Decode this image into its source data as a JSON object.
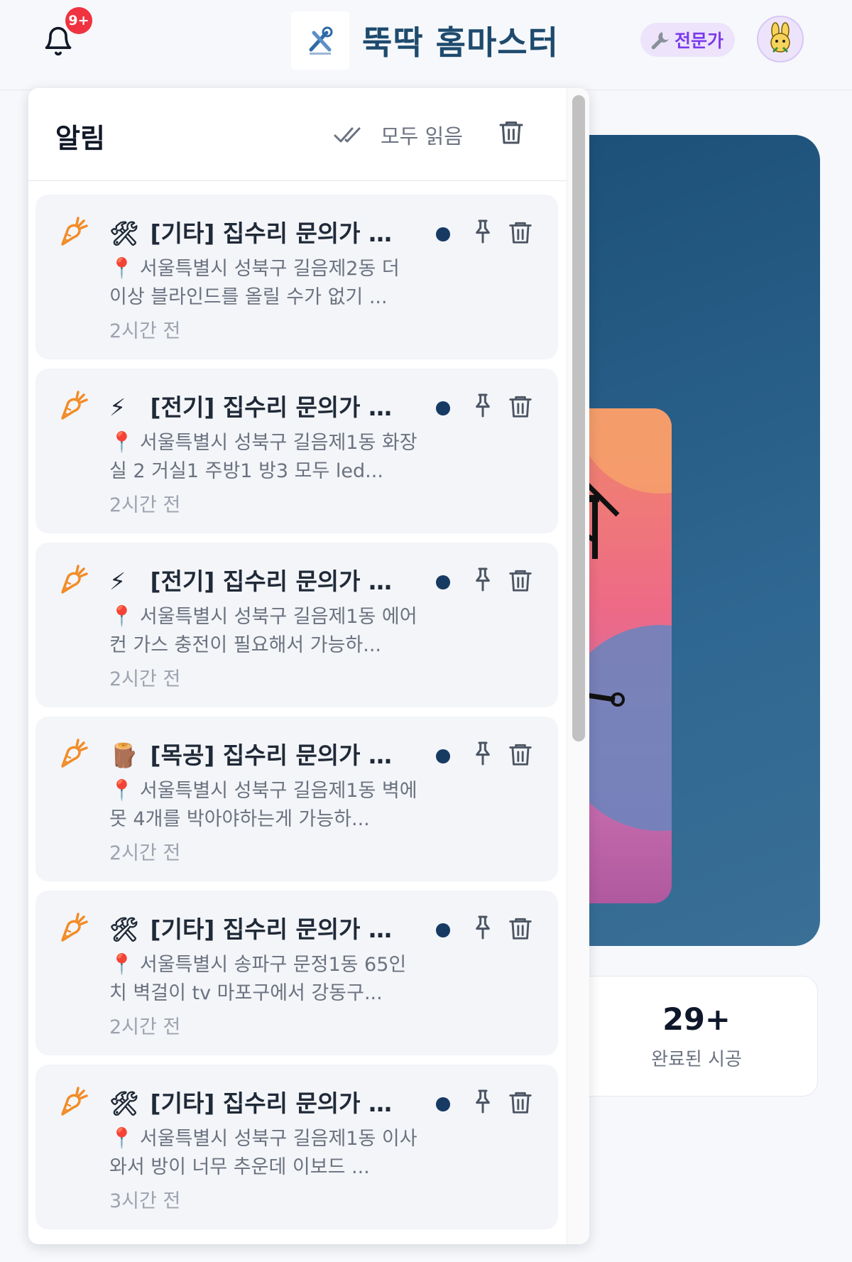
{
  "header": {
    "notification_badge": "9+",
    "app_title": "뚝딱 홈마스터",
    "role_badge": {
      "icon": "wrench-icon",
      "label": "전문가"
    },
    "avatar": "avatar"
  },
  "stat": {
    "value": "29+",
    "label": "완료된 시공"
  },
  "panel": {
    "title": "알림",
    "read_all_label": "모두 읽음",
    "clear_icon": "trash-icon"
  },
  "notifications": [
    {
      "category_emoji": "🛠",
      "title": "[기타] 집수리 문의가 올...",
      "location_icon": "📍",
      "body": "서울특별시 성북구 길음제2동 더 이상 블라인드를 올릴 수가 없기 ...",
      "time": "2시간 전",
      "unread": true
    },
    {
      "category_emoji": "⚡",
      "title": "[전기] 집수리 문의가 올...",
      "location_icon": "📍",
      "body": "서울특별시 성북구 길음제1동 화장실 2 거실1 주방1 방3 모두 led...",
      "time": "2시간 전",
      "unread": true
    },
    {
      "category_emoji": "⚡",
      "title": "[전기] 집수리 문의가 올...",
      "location_icon": "📍",
      "body": "서울특별시 성북구 길음제1동 에어컨 가스 충전이 필요해서 가능하...",
      "time": "2시간 전",
      "unread": true
    },
    {
      "category_emoji": "🪵",
      "title": "[목공] 집수리 문의가 올...",
      "location_icon": "📍",
      "body": "서울특별시 성북구 길음제1동 벽에 못 4개를 박아야하는게 가능하...",
      "time": "2시간 전",
      "unread": true
    },
    {
      "category_emoji": "🛠",
      "title": "[기타] 집수리 문의가 올...",
      "location_icon": "📍",
      "body": "서울특별시 송파구 문정1동 65인치 벽걸이 tv 마포구에서 강동구...",
      "time": "2시간 전",
      "unread": true
    },
    {
      "category_emoji": "🛠",
      "title": "[기타] 집수리 문의가 올...",
      "location_icon": "📍",
      "body": "서울특별시 성북구 길음제1동 이사와서 방이 너무 추운데 이보드 ...",
      "time": "3시간 전",
      "unread": true
    }
  ],
  "colors": {
    "accent": "#1e4a6e",
    "badge": "#ef3340",
    "role": "#7c3aed",
    "carrot": "#f28c28",
    "unread_dot": "#173a63"
  }
}
